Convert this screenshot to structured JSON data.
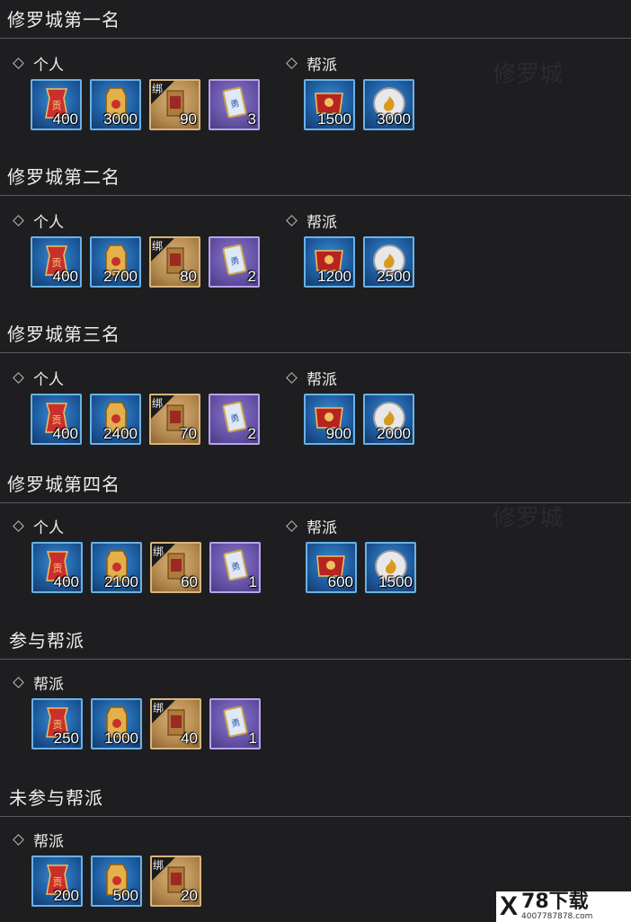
{
  "labels": {
    "personal": "个人",
    "guild": "帮派",
    "bind": "绑"
  },
  "watermark": {
    "brand": "78下载",
    "site": "4007787878.com"
  },
  "sections": [
    {
      "title": "修罗城第一名",
      "personal": [
        "400",
        "3000",
        "90",
        "3"
      ],
      "guild": [
        "1500",
        "3000"
      ]
    },
    {
      "title": "修罗城第二名",
      "personal": [
        "400",
        "2700",
        "80",
        "2"
      ],
      "guild": [
        "1200",
        "2500"
      ]
    },
    {
      "title": "修罗城第三名",
      "personal": [
        "400",
        "2400",
        "70",
        "2"
      ],
      "guild": [
        "900",
        "2000"
      ]
    },
    {
      "title": "修罗城第四名",
      "personal": [
        "400",
        "2100",
        "60",
        "1"
      ],
      "guild": [
        "600",
        "1500"
      ]
    },
    {
      "title": "参与帮派",
      "rewards": [
        "250",
        "1000",
        "40",
        "1"
      ]
    },
    {
      "title": "未参与帮派",
      "rewards": [
        "200",
        "500",
        "20"
      ]
    }
  ],
  "item_types": {
    "personal": [
      "contribution-token-icon",
      "gold-tag-icon",
      "bound-scroll-icon",
      "talisman-card-icon"
    ],
    "guild": [
      "guild-banner-icon",
      "silver-coin-icon"
    ]
  }
}
